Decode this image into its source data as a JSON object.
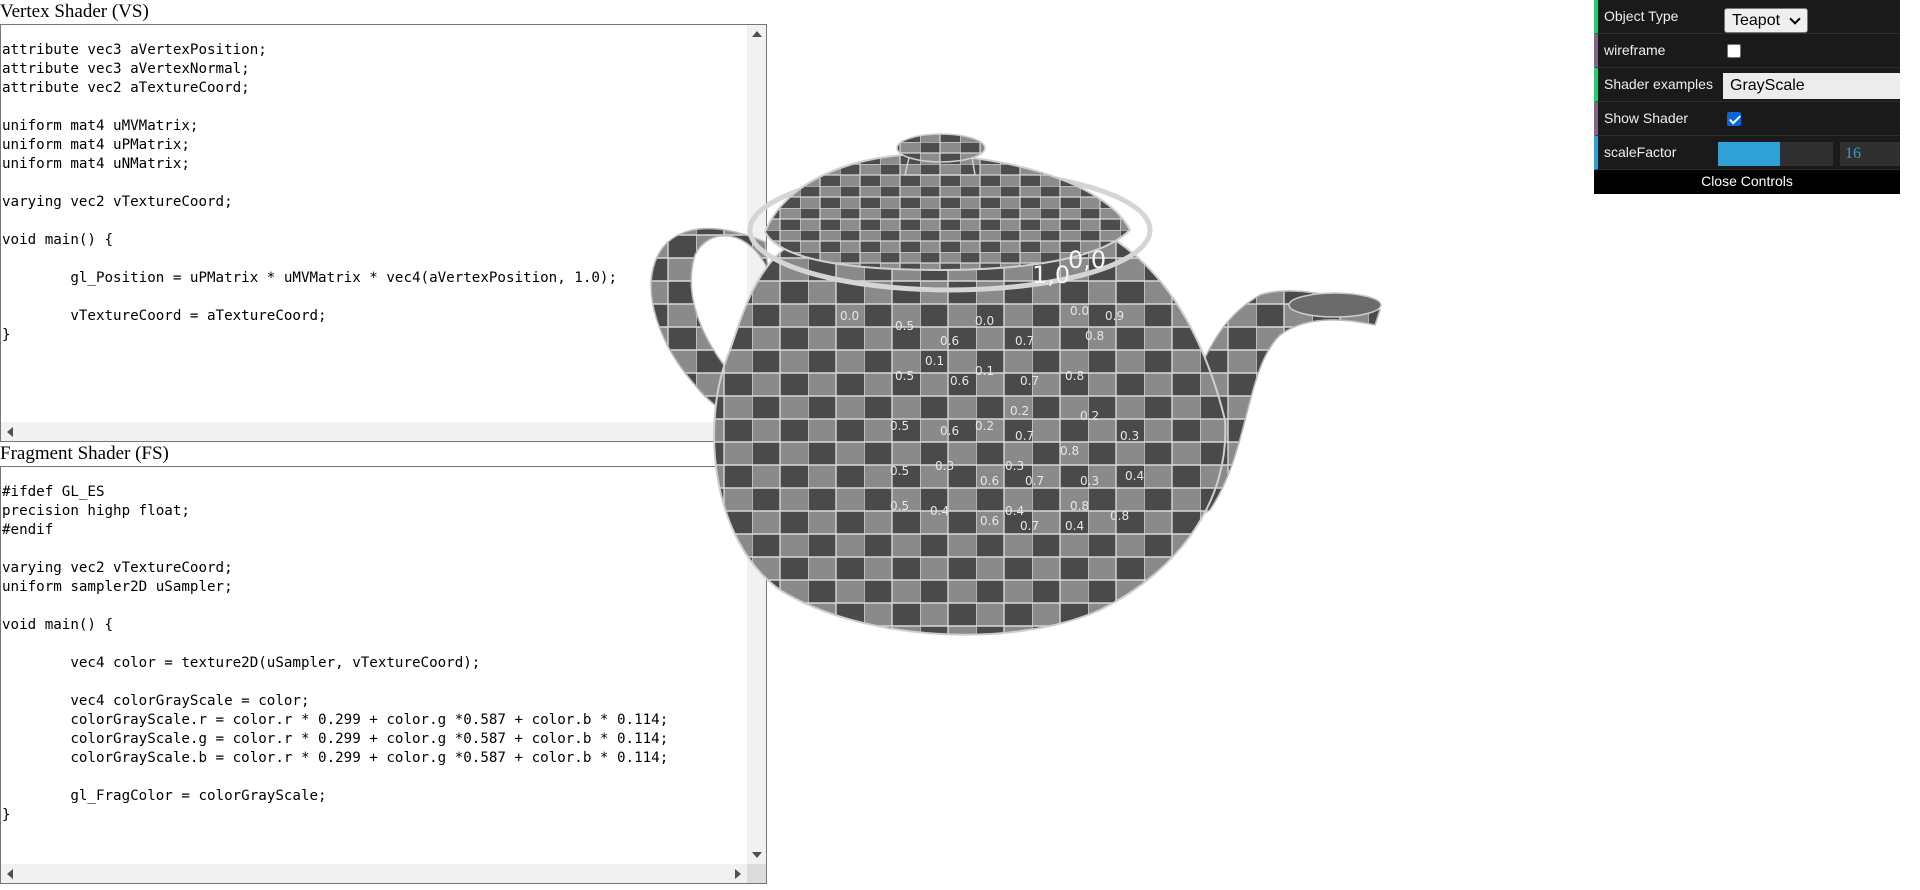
{
  "vertex": {
    "title": "Vertex Shader (VS)",
    "code": "attribute vec3 aVertexPosition;\nattribute vec3 aVertexNormal;\nattribute vec2 aTextureCoord;\n\nuniform mat4 uMVMatrix;\nuniform mat4 uPMatrix;\nuniform mat4 uNMatrix;\n\nvarying vec2 vTextureCoord;\n\nvoid main() {\n\n\tgl_Position = uPMatrix * uMVMatrix * vec4(aVertexPosition, 1.0);\n\n\tvTextureCoord = aTextureCoord;\n}"
  },
  "fragment": {
    "title": "Fragment Shader (FS)",
    "code": "#ifdef GL_ES\nprecision highp float;\n#endif\n\nvarying vec2 vTextureCoord;\nuniform sampler2D uSampler;\n\nvoid main() {\n\n\tvec4 color = texture2D(uSampler, vTextureCoord);\n\n\tvec4 colorGrayScale = color;\n\tcolorGrayScale.r = color.r * 0.299 + color.g *0.587 + color.b * 0.114;\n\tcolorGrayScale.g = color.r * 0.299 + color.g *0.587 + color.b * 0.114;\n\tcolorGrayScale.b = color.r * 0.299 + color.g *0.587 + color.b * 0.114;\n\n\tgl_FragColor = colorGrayScale;\n}"
  },
  "controls": {
    "object_type_label": "Object Type",
    "object_type_value": "Teapot",
    "wireframe_label": "wireframe",
    "wireframe_checked": false,
    "shader_examples_label": "Shader examples",
    "shader_examples_value": "GrayScale",
    "show_shader_label": "Show Shader",
    "show_shader_checked": true,
    "scale_factor_label": "scaleFactor",
    "scale_factor_value": "16",
    "scale_factor_fraction": 0.54,
    "close_label": "Close Controls"
  },
  "scene": {
    "labels": [
      "0.0",
      "0.5",
      "0.6",
      "0.0",
      "0.7",
      "0.8",
      "0.0",
      "0.9",
      "0.5",
      "0.1",
      "0.6",
      "0.1",
      "0.7",
      "0.8",
      "0.2",
      "0.5",
      "0.6",
      "0.2",
      "0.7",
      "0.2",
      "0.8",
      "0.3",
      "0.5",
      "0.3",
      "0.6",
      "0.3",
      "0.7",
      "0.3",
      "0.8",
      "0.4",
      "0.5",
      "0.4",
      "0.6",
      "0.4",
      "0.7",
      "0.4",
      "0.8",
      "1,0",
      "0,0"
    ]
  },
  "colors": {
    "accent": "#2fa1d6",
    "gui_bg": "#1a1a1a",
    "checkbox": "#0a66d8"
  }
}
